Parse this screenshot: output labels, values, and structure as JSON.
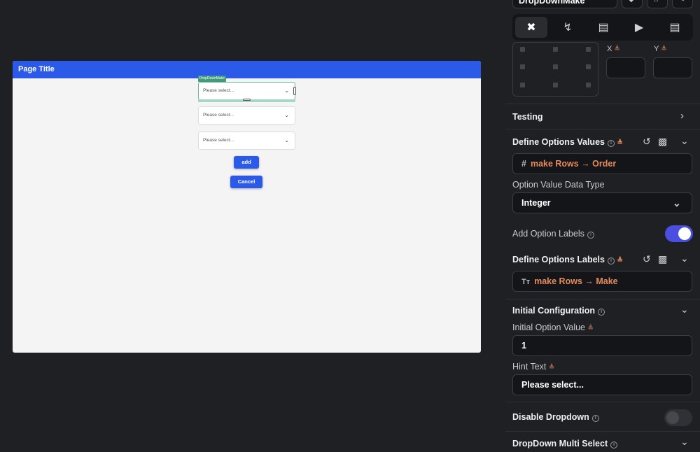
{
  "canvas": {
    "page_title": "Page Title",
    "widget_tag": "DropDownMake",
    "dropdowns": [
      {
        "placeholder": "Please select..."
      },
      {
        "placeholder": "Please select..."
      },
      {
        "placeholder": "Please select..."
      }
    ],
    "add_button": "add",
    "cancel_button": "Cancel"
  },
  "panel": {
    "widget_name": "DropDownMake",
    "tabs": [
      "properties-icon",
      "actions-icon",
      "backend-query-icon",
      "play-icon",
      "doc-add-icon"
    ],
    "x_label": "X",
    "y_label": "Y",
    "testing": "Testing",
    "define_values": {
      "title": "Define Options Values",
      "value_prefix": "#",
      "value": "make Rows → Order"
    },
    "value_type": {
      "label": "Option Value Data Type",
      "selected": "Integer"
    },
    "add_option_labels": {
      "label": "Add Option Labels",
      "on": true
    },
    "define_labels": {
      "title": "Define Options Labels",
      "value_prefix": "Tт",
      "value": "make Rows → Make"
    },
    "initial_config": {
      "title": "Initial Configuration",
      "initial_value_label": "Initial Option Value",
      "initial_value": "1",
      "hint_label": "Hint Text",
      "hint_value": "Please select..."
    },
    "disable_dropdown": {
      "label": "Disable Dropdown",
      "on": false
    },
    "multi_select": {
      "label": "DropDown Multi Select"
    },
    "colors": {
      "accent": "#2b5ae8",
      "toggle_on": "#4a4fe0",
      "variable": "#e58a5a"
    }
  }
}
